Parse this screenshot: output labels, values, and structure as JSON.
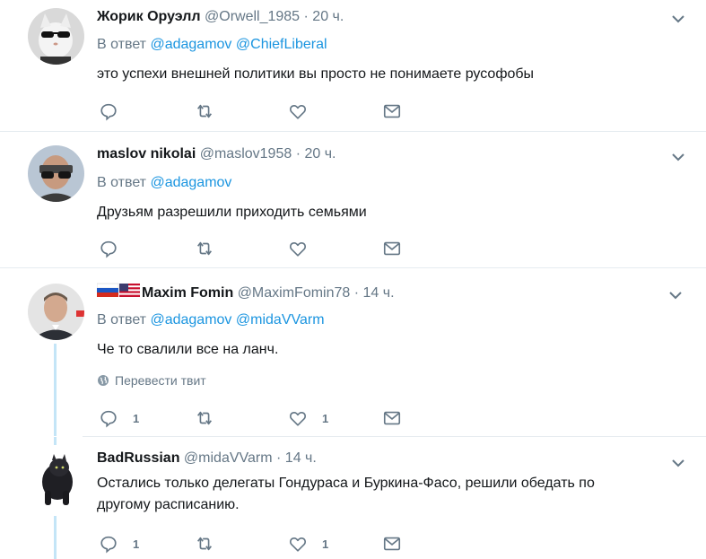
{
  "tweets": [
    {
      "name": "Жорик Оруэлл",
      "handle": "@Orwell_1985",
      "time": "· 20 ч.",
      "reply_prefix": "В ответ",
      "mentions": [
        "@adagamov",
        "@ChiefLiberal"
      ],
      "text": "это успехи внешней политики вы просто не понимаете русофобы",
      "reply_count": "",
      "like_count": ""
    },
    {
      "name": "maslov nikolai",
      "handle": "@maslov1958",
      "time": "· 20 ч.",
      "reply_prefix": "В ответ",
      "mentions": [
        "@adagamov"
      ],
      "text": "Друзьям разрешили приходить семьями",
      "reply_count": "",
      "like_count": ""
    },
    {
      "name": "Maxim Fomin",
      "handle": "@MaximFomin78",
      "time": "· 14 ч.",
      "reply_prefix": "В ответ",
      "mentions": [
        "@adagamov",
        "@midaVVarm"
      ],
      "text": "Че то свалили все на ланч.",
      "translate_label": "Перевести твит",
      "reply_count": "1",
      "like_count": "1"
    },
    {
      "name": "BadRussian",
      "handle": "@midaVVarm",
      "time": "· 14 ч.",
      "text_line1": "Остались только делегаты Гондураса и Буркина-Фасо, решили обедать по",
      "text_line2": "другому расписанию.",
      "reply_count": "1",
      "like_count": "1"
    }
  ],
  "icons": {
    "reply": "reply-icon",
    "retweet": "retweet-icon",
    "like": "heart-icon",
    "dm": "envelope-icon",
    "more": "chevron-down-icon",
    "globe": "globe-icon"
  },
  "colors": {
    "link": "#1b95e0",
    "muted": "#657786",
    "text": "#14171a",
    "thread": "#c4e5f7",
    "divider": "#e6ecf0"
  }
}
